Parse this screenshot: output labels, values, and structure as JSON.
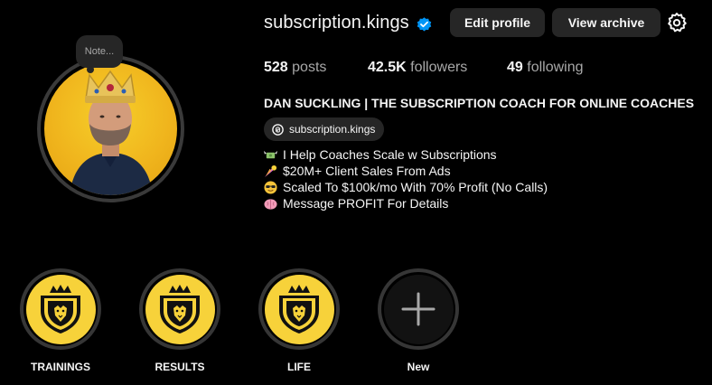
{
  "profile": {
    "username": "subscription.kings",
    "note_placeholder": "Note...",
    "buttons": {
      "edit": "Edit profile",
      "archive": "View archive"
    },
    "stats": {
      "posts_count": "528",
      "posts_label": "posts",
      "followers_count": "42.5K",
      "followers_label": "followers",
      "following_count": "49",
      "following_label": "following"
    },
    "full_name": "DAN SUCKLING | THE SUBSCRIPTION COACH FOR ONLINE COACHES",
    "threads_handle": "subscription.kings",
    "bio_lines": [
      {
        "icon": "money-wings-emoji",
        "text": "I Help Coaches Scale w Subscriptions"
      },
      {
        "icon": "comet-emoji",
        "text": "$20M+ Client Sales From Ads"
      },
      {
        "icon": "sunglasses-emoji",
        "text": "Scaled To $100k/mo With 70% Profit (No Calls)"
      },
      {
        "icon": "brain-emoji",
        "text": "Message PROFIT For Details"
      }
    ]
  },
  "highlights": [
    {
      "label": "TRAININGS",
      "icon": "lion-crest-icon"
    },
    {
      "label": "RESULTS",
      "icon": "lion-crest-icon"
    },
    {
      "label": "LIFE",
      "icon": "lion-crest-icon"
    },
    {
      "label": "New",
      "icon": "plus-icon"
    }
  ],
  "colors": {
    "background": "#000000",
    "button_bg": "#262626",
    "verified_blue": "#0095f6",
    "highlight_yellow": "#f7d23a",
    "avatar_yellow": "#f0b51d"
  }
}
